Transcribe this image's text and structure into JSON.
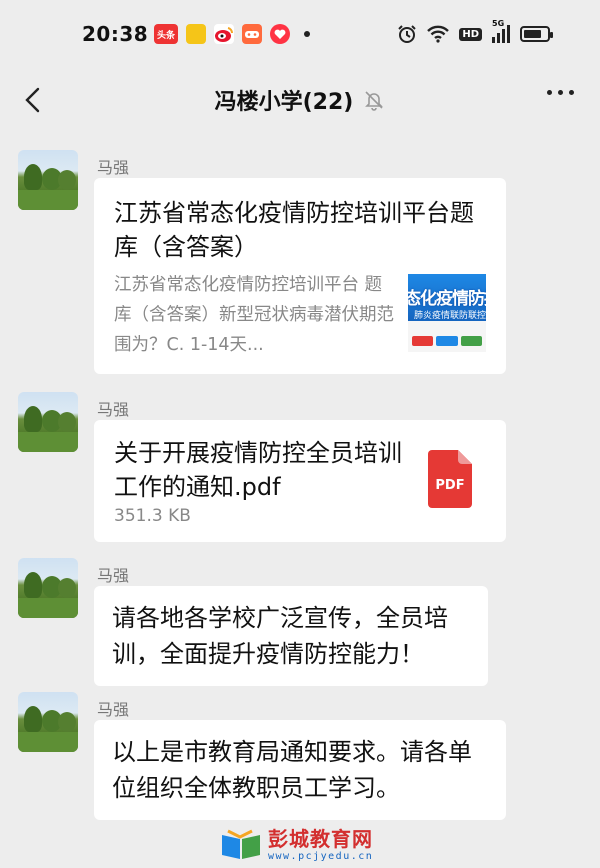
{
  "status_bar": {
    "time": "20:38",
    "notification_icons": [
      "toutiao-icon",
      "yellow-app-icon",
      "weibo-icon",
      "game-icon",
      "heart-app-icon"
    ],
    "toutiao_label": "头条",
    "hd_badge": "HD",
    "network": "5G"
  },
  "nav": {
    "title": "冯楼小学(22)"
  },
  "messages": [
    {
      "sender": "马强",
      "type": "link",
      "title": "江苏省常态化疫情防控培训平台题库（含答案）",
      "description": "江苏省常态化疫情防控培训平台 题库（含答案）新型冠状病毒潜伏期范围为？C. 1-14天...",
      "thumbnail_text": "态化疫情防控",
      "thumbnail_subtext": "肺炎疫情联防联控指"
    },
    {
      "sender": "马强",
      "type": "file",
      "file_name": "关于开展疫情防控全员培训工作的通知.pdf",
      "file_size": "351.3 KB",
      "file_icon_label": "PDF"
    },
    {
      "sender": "马强",
      "type": "text",
      "text": "请各地各学校广泛宣传，全员培训，全面提升疫情防控能力！"
    },
    {
      "sender": "马强",
      "type": "text",
      "text": "以上是市教育局通知要求。请各单位组织全体教职员工学习。"
    }
  ],
  "watermark": {
    "name": "彭城教育网",
    "url": "www.pcjyedu.cn"
  },
  "colors": {
    "background": "#ededed",
    "bubble": "#ffffff",
    "pdf_red": "#e53935",
    "watermark_red": "#d32f2f"
  }
}
